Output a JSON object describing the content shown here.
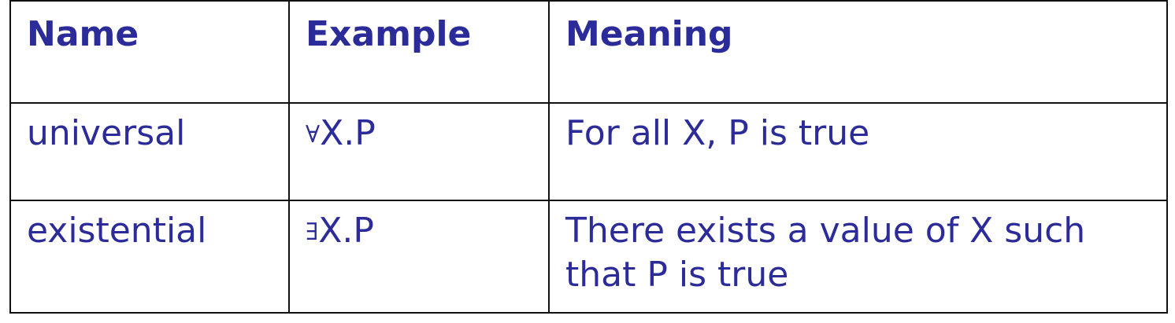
{
  "table": {
    "headers": [
      "Name",
      "Example",
      "Meaning"
    ],
    "rows": [
      {
        "name": "universal",
        "example_symbol": "∀",
        "example_text": "X.P",
        "meaning": "For all X, P is true"
      },
      {
        "name": "existential",
        "example_symbol": "∃",
        "example_text": "X.P",
        "meaning": "There exists a value of X such that P is true"
      }
    ]
  },
  "colors": {
    "text": "#2b2b9a",
    "border": "#111111",
    "background": "#ffffff"
  }
}
